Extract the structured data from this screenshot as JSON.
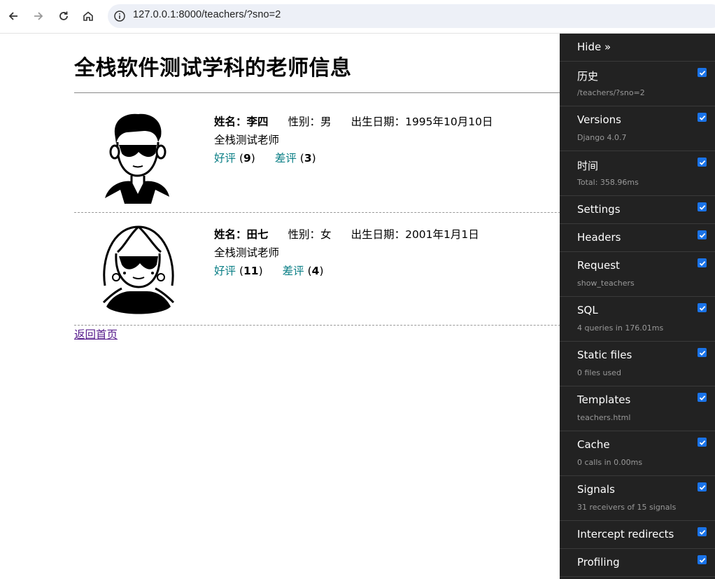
{
  "browser": {
    "url": "127.0.0.1:8000/teachers/?sno=2"
  },
  "page": {
    "title": "全栈软件测试学科的老师信息",
    "back_link": "返回首页"
  },
  "teachers": [
    {
      "name_label": "姓名：",
      "name": "李四",
      "gender_label": "性别：",
      "gender": "男",
      "birth_label": "出生日期：",
      "birth": "1995年10月10日",
      "intro": "全栈测试老师",
      "good_label": "好评",
      "good_count": "9",
      "bad_label": "差评",
      "bad_count": "3"
    },
    {
      "name_label": "姓名：",
      "name": "田七",
      "gender_label": "性别：",
      "gender": "女",
      "birth_label": "出生日期：",
      "birth": "2001年1月1日",
      "intro": "全栈测试老师",
      "good_label": "好评",
      "good_count": "11",
      "bad_label": "差评",
      "bad_count": "4"
    }
  ],
  "toolbar": {
    "hide_label": "Hide »",
    "panels": [
      {
        "title": "历史",
        "sub": "/teachers/?sno=2"
      },
      {
        "title": "Versions",
        "sub": "Django 4.0.7"
      },
      {
        "title": "时间",
        "sub": "Total: 358.96ms"
      },
      {
        "title": "Settings",
        "sub": ""
      },
      {
        "title": "Headers",
        "sub": ""
      },
      {
        "title": "Request",
        "sub": "show_teachers"
      },
      {
        "title": "SQL",
        "sub": "4 queries in 176.01ms"
      },
      {
        "title": "Static files",
        "sub": "0 files used"
      },
      {
        "title": "Templates",
        "sub": "teachers.html"
      },
      {
        "title": "Cache",
        "sub": "0 calls in 0.00ms"
      },
      {
        "title": "Signals",
        "sub": "31 receivers of 15 signals"
      },
      {
        "title": "Intercept redirects",
        "sub": ""
      },
      {
        "title": "Profiling",
        "sub": ""
      }
    ]
  },
  "colors": {
    "link_review": "#0b7f86",
    "link_visited": "#551a8b",
    "toolbar_bg": "#222222",
    "checkbox": "#1a73e8"
  }
}
